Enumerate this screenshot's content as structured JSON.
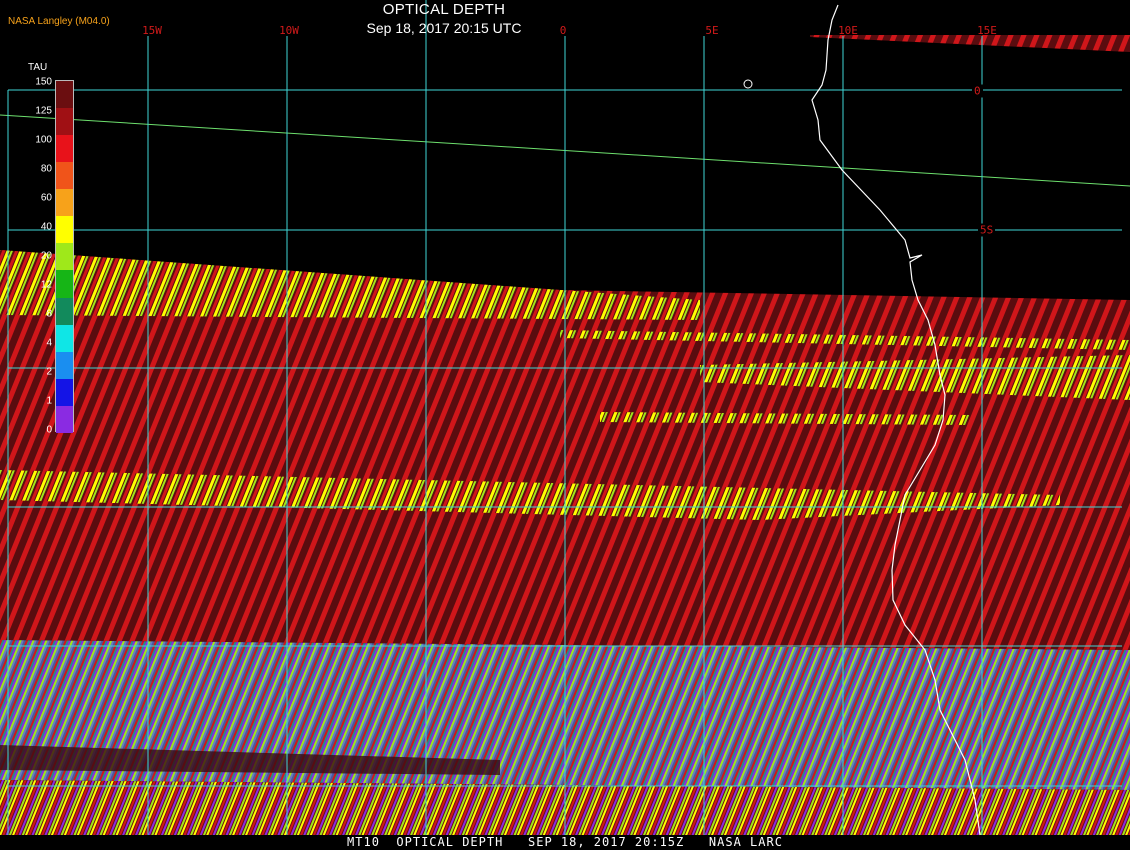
{
  "header": {
    "title": "OPTICAL DEPTH",
    "subtitle": "Sep 18, 2017 20:15 UTC",
    "credit": "NASA Langley (M04.0)"
  },
  "footer": {
    "text": "MT10  OPTICAL DEPTH   SEP 18, 2017 20:15Z   NASA LARC"
  },
  "map": {
    "region": "Southeast Atlantic / SW Africa coast",
    "lon_labels": [
      "15W",
      "10W",
      "0",
      "5E",
      "10E",
      "15E"
    ],
    "lat_labels": [
      "0",
      "5S"
    ],
    "colors": {
      "grid": "#3fd6d6",
      "label": "#d21a1a",
      "coastline": "#ffffff",
      "terminator": "#6ee06e",
      "thick_cloud": "#6a0f12",
      "stripe_red": "#d0161a"
    }
  },
  "legend": {
    "title": "TAU",
    "ticks": [
      "150",
      "125",
      "100",
      "80",
      "60",
      "40",
      "20",
      "12",
      "8",
      "4",
      "2",
      "1",
      "0"
    ],
    "colors": [
      "#6b0e10",
      "#a01014",
      "#e8121a",
      "#f0541a",
      "#f7a21a",
      "#ffff00",
      "#9fe81a",
      "#16b516",
      "#128a5c",
      "#0fe6e6",
      "#1a8ef0",
      "#1414e6",
      "#8a2be2"
    ]
  }
}
